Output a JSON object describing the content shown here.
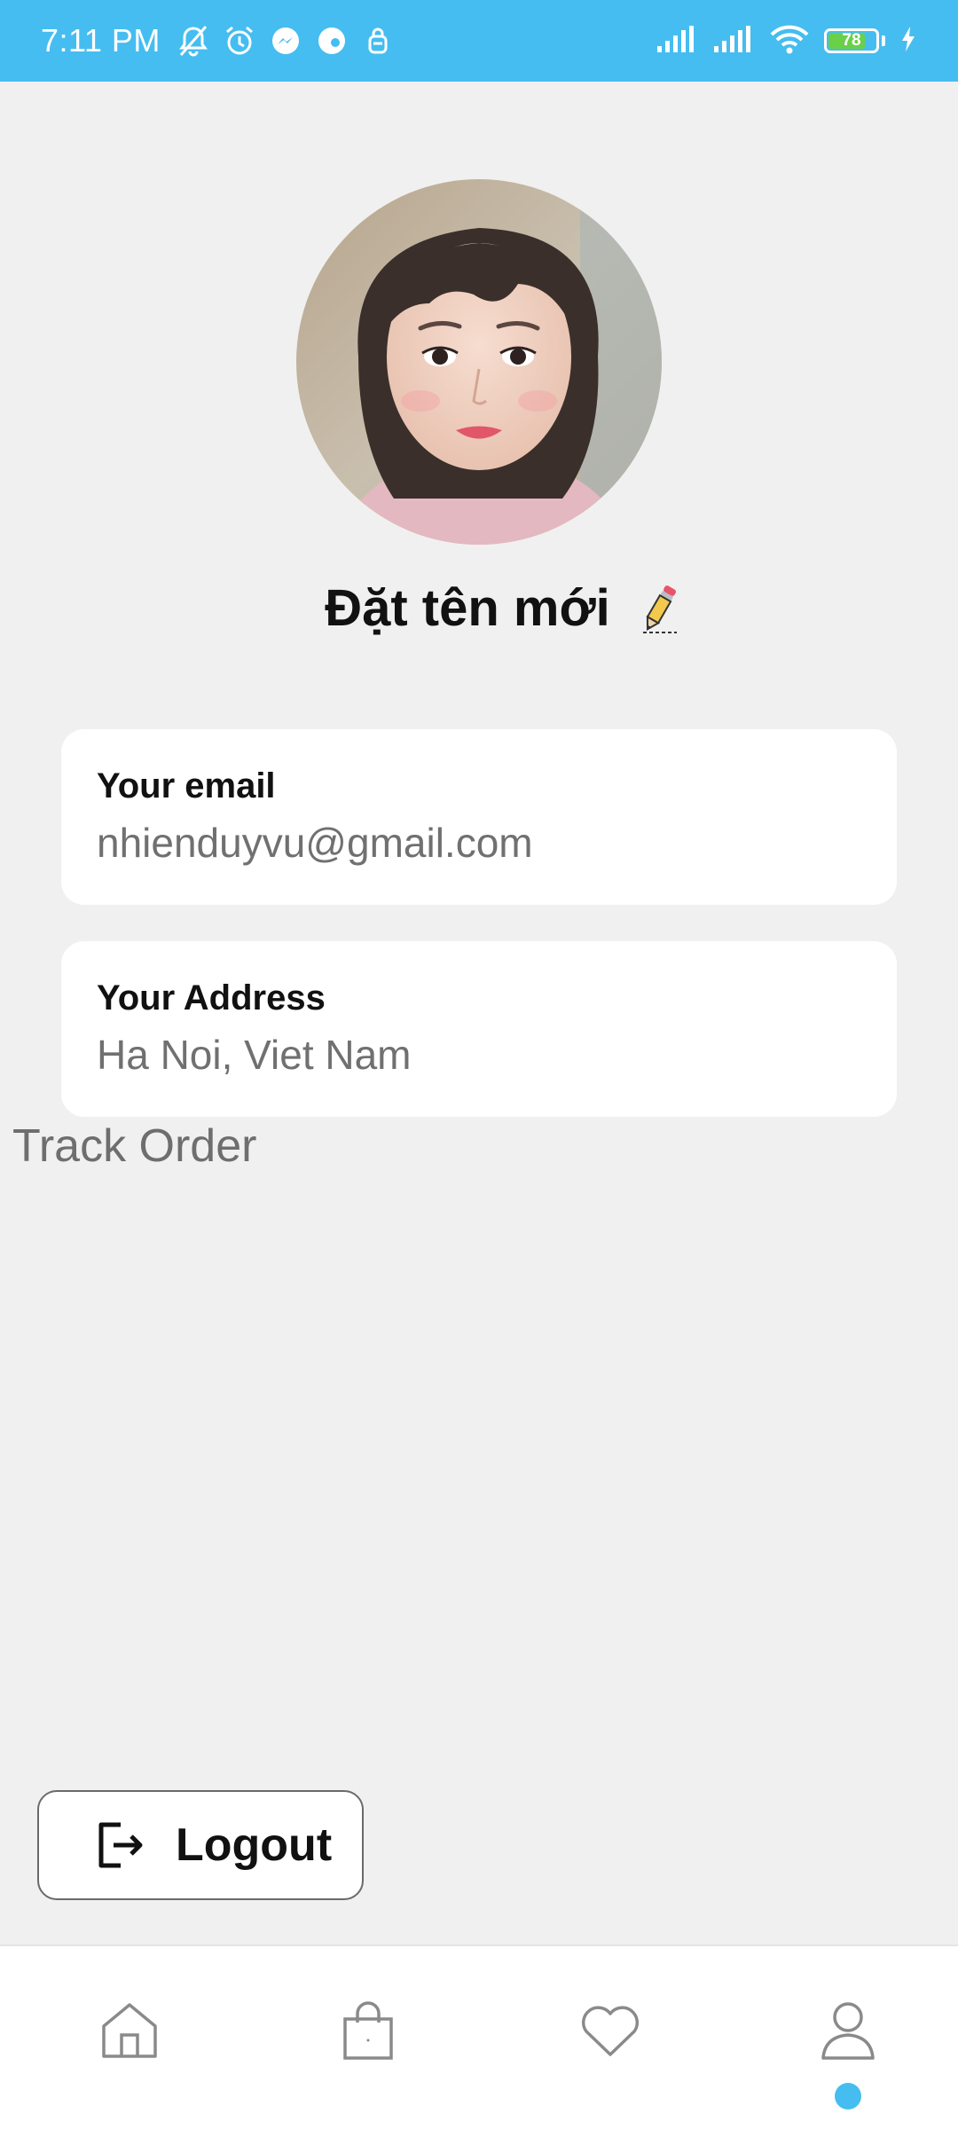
{
  "status_bar": {
    "time": "7:11 PM",
    "battery_level": 78,
    "battery_text": "78",
    "background_color": "#45bdf0",
    "icons": [
      "bell-off-icon",
      "alarm-icon",
      "messenger-icon",
      "chat-app-icon",
      "vpn-key-icon",
      "signal-icon",
      "signal-icon",
      "wifi-icon",
      "battery-icon",
      "charging-icon"
    ]
  },
  "profile": {
    "name": "Đặt tên mới",
    "edit_icon": "pencil-icon"
  },
  "email_card": {
    "label": "Your email",
    "value": "nhienduyvu@gmail.com"
  },
  "address_card": {
    "label": "Your Address",
    "value": "Ha Noi, Viet Nam"
  },
  "track_order": {
    "label": "Track Order"
  },
  "logout": {
    "label": "Logout",
    "icon": "logout-icon"
  },
  "bottom_nav": {
    "items": [
      {
        "icon": "home-icon",
        "active": false
      },
      {
        "icon": "shopping-bag-icon",
        "active": false
      },
      {
        "icon": "heart-icon",
        "active": false
      },
      {
        "icon": "user-icon",
        "active": true
      }
    ],
    "active_indicator_color": "#45bdf0"
  }
}
